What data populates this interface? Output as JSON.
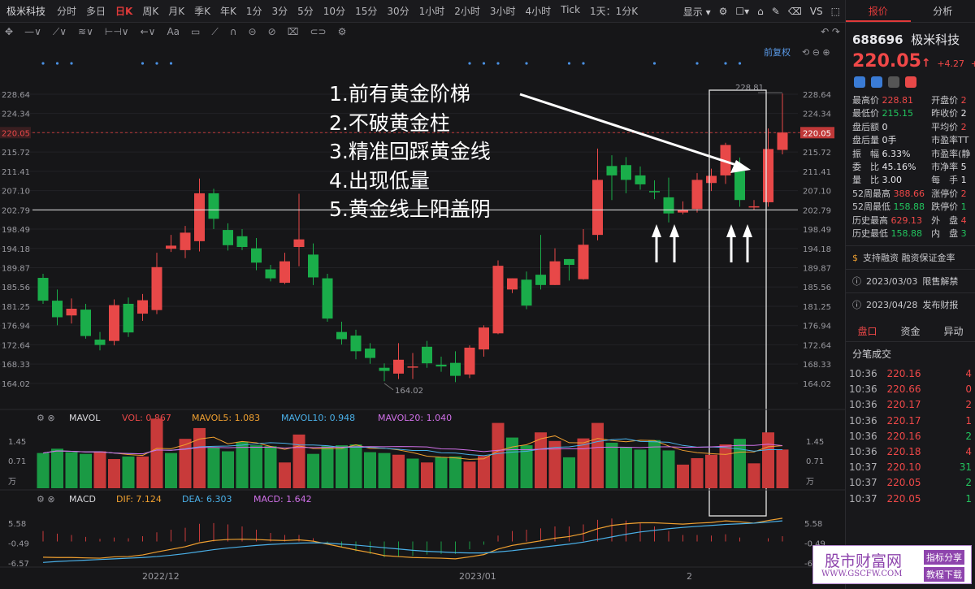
{
  "toolbar": {
    "symbol": "极米科技",
    "periods": [
      "分时",
      "多日",
      "日K",
      "周K",
      "月K",
      "季K",
      "年K",
      "1分",
      "3分",
      "5分",
      "10分",
      "15分",
      "30分",
      "1小时",
      "2小时",
      "3小时",
      "4小时",
      "Tick",
      "1天：1分K"
    ],
    "active_period": "日K",
    "display_label": "显示",
    "vs_label": "VS"
  },
  "chart": {
    "adjust_label": "前复权",
    "y_ticks": [
      "228.64",
      "224.34",
      "220.05",
      "215.72",
      "211.41",
      "207.10",
      "202.79",
      "198.49",
      "194.18",
      "189.87",
      "185.56",
      "181.25",
      "176.94",
      "172.64",
      "168.33",
      "164.02"
    ],
    "current_price_label": "220.05",
    "high_label": "228.81",
    "low_label": "164.02",
    "x_labels": [
      "2022/12",
      "2023/01",
      "2"
    ],
    "annotations": [
      "1.前有黄金阶梯",
      "2.不破黄金柱",
      "3.精准回踩黄金线",
      "4.出现低量",
      "5.黄金线上阳盖阴"
    ],
    "colors": {
      "up": "#e84848",
      "down": "#1aad4a",
      "bg": "#161618"
    }
  },
  "mavol": {
    "name": "MAVOL",
    "vol_label": "VOL:",
    "vol": "0.867",
    "ma5_label": "MAVOL5:",
    "ma5": "1.083",
    "ma10_label": "MAVOL10:",
    "ma10": "0.948",
    "ma20_label": "MAVOL20:",
    "ma20": "1.040",
    "y_ticks": [
      "1.45",
      "0.71",
      "万"
    ]
  },
  "macd": {
    "name": "MACD",
    "dif_label": "DIF:",
    "dif": "7.124",
    "dea_label": "DEA:",
    "dea": "6.303",
    "macd_label": "MACD:",
    "macd": "1.642",
    "y_ticks": [
      "5.58",
      "-0.49",
      "-6.57"
    ]
  },
  "chart_data": {
    "type": "candlestick",
    "candles": [
      [
        187.6,
        182.5,
        188.5,
        181.8
      ],
      [
        182.5,
        178.8,
        185.0,
        177.0
      ],
      [
        179.2,
        180.7,
        183.0,
        177.4
      ],
      [
        180.5,
        174.6,
        181.8,
        174.0
      ],
      [
        173.8,
        172.6,
        175.5,
        171.4
      ],
      [
        173.5,
        181.5,
        182.8,
        172.5
      ],
      [
        181.8,
        175.4,
        183.2,
        174.4
      ],
      [
        179.6,
        182.6,
        184.0,
        178.0
      ],
      [
        180.4,
        190.0,
        193.2,
        179.5
      ],
      [
        194.1,
        194.8,
        197.2,
        193.4
      ],
      [
        193.8,
        197.7,
        199.2,
        192.0
      ],
      [
        195.8,
        206.5,
        209.8,
        193.5
      ],
      [
        206.5,
        200.8,
        207.5,
        198.5
      ],
      [
        198.3,
        194.9,
        199.8,
        193.7
      ],
      [
        196.9,
        194.5,
        198.5,
        193.8
      ],
      [
        194.2,
        191.0,
        196.5,
        189.3
      ],
      [
        189.5,
        187.5,
        190.5,
        186.8
      ],
      [
        186.5,
        191.3,
        193.2,
        186.2
      ],
      [
        194.5,
        196.2,
        206.4,
        190.2
      ],
      [
        192.8,
        187.7,
        195.3,
        186.0
      ],
      [
        187.5,
        178.5,
        188.5,
        177.8
      ],
      [
        175.5,
        173.9,
        177.8,
        172.7
      ],
      [
        174.7,
        171.2,
        176.0,
        169.4
      ],
      [
        171.8,
        169.7,
        173.0,
        168.4
      ],
      [
        167.5,
        166.8,
        168.5,
        164.5
      ],
      [
        166.2,
        169.3,
        173.0,
        165.0
      ],
      [
        167.8,
        167.8,
        170.8,
        165.0
      ],
      [
        172.2,
        168.5,
        173.5,
        167.5
      ],
      [
        168.2,
        167.8,
        170.0,
        166.6
      ],
      [
        168.6,
        165.7,
        171.2,
        164.3
      ],
      [
        166.0,
        172.0,
        172.5,
        165.2
      ],
      [
        171.6,
        176.5,
        177.0,
        170.0
      ],
      [
        175.2,
        190.3,
        191.5,
        175.0
      ],
      [
        185.0,
        187.5,
        187.5,
        184.2
      ],
      [
        187.2,
        181.4,
        189.0,
        180.6
      ],
      [
        188.3,
        186.0,
        197.2,
        185.0
      ],
      [
        186.0,
        191.3,
        194.2,
        186.0
      ],
      [
        191.8,
        190.5,
        191.8,
        187.0
      ],
      [
        187.3,
        195.0,
        198.5,
        187.2
      ],
      [
        197.2,
        209.5,
        216.5,
        196.0
      ],
      [
        212.6,
        210.5,
        215.0,
        205.0
      ],
      [
        212.8,
        209.5,
        214.6,
        206.5
      ],
      [
        210.5,
        208.5,
        212.5,
        207.3
      ],
      [
        207.0,
        206.8,
        209.4,
        205.2
      ],
      [
        205.6,
        202.0,
        210.0,
        200.0
      ],
      [
        202.2,
        202.8,
        204.7,
        201.8
      ],
      [
        203.0,
        209.5,
        211.0,
        202.2
      ],
      [
        208.8,
        210.4,
        212.0,
        207.0
      ],
      [
        210.5,
        217.3,
        217.8,
        208.6
      ],
      [
        211.5,
        205.0,
        214.5,
        203.5
      ],
      [
        203.5,
        203.6,
        205.0,
        202.8
      ],
      [
        204.5,
        216.4,
        221.0,
        203.5
      ],
      [
        216.2,
        220.1,
        228.8,
        215.2
      ]
    ],
    "high": 228.81,
    "low": 164.02,
    "ylim": [
      162.0,
      231.0
    ],
    "horizontal_line": 202.79,
    "volume": [
      [
        0.82,
        0
      ],
      [
        0.92,
        0
      ],
      [
        0.84,
        0
      ],
      [
        0.8,
        0
      ],
      [
        0.86,
        1
      ],
      [
        0.68,
        1
      ],
      [
        0.74,
        0
      ],
      [
        0.74,
        1
      ],
      [
        1.62,
        1
      ],
      [
        0.82,
        0
      ],
      [
        1.15,
        1
      ],
      [
        1.4,
        1
      ],
      [
        0.95,
        0
      ],
      [
        0.86,
        0
      ],
      [
        1.08,
        0
      ],
      [
        1.0,
        0
      ],
      [
        0.98,
        0
      ],
      [
        0.6,
        1
      ],
      [
        1.25,
        1
      ],
      [
        0.8,
        0
      ],
      [
        0.98,
        0
      ],
      [
        1.0,
        0
      ],
      [
        1.02,
        0
      ],
      [
        0.84,
        0
      ],
      [
        0.82,
        0
      ],
      [
        0.78,
        1
      ],
      [
        0.69,
        0
      ],
      [
        0.6,
        1
      ],
      [
        0.72,
        0
      ],
      [
        0.74,
        0
      ],
      [
        0.62,
        1
      ],
      [
        0.75,
        1
      ],
      [
        1.52,
        1
      ],
      [
        1.18,
        0
      ],
      [
        1.0,
        0
      ],
      [
        1.3,
        1
      ],
      [
        1.1,
        1
      ],
      [
        0.72,
        0
      ],
      [
        1.16,
        1
      ],
      [
        1.52,
        1
      ],
      [
        1.06,
        0
      ],
      [
        0.95,
        0
      ],
      [
        0.9,
        0
      ],
      [
        1.12,
        0
      ],
      [
        0.88,
        0
      ],
      [
        0.55,
        1
      ],
      [
        0.7,
        1
      ],
      [
        0.78,
        1
      ],
      [
        1.02,
        1
      ],
      [
        1.15,
        0
      ],
      [
        0.58,
        1
      ],
      [
        1.3,
        1
      ],
      [
        0.9,
        1
      ]
    ],
    "macd_dif": [
      -4.8,
      -4.9,
      -4.9,
      -5.0,
      -5.1,
      -4.7,
      -4.6,
      -4.1,
      -3.2,
      -2.4,
      -1.6,
      -0.4,
      0.3,
      0.6,
      0.7,
      0.6,
      0.4,
      0.3,
      0.5,
      0.1,
      -0.8,
      -1.7,
      -2.6,
      -3.4,
      -4.3,
      -4.6,
      -4.9,
      -5.0,
      -5.1,
      -5.3,
      -4.7,
      -4.0,
      -2.3,
      -1.2,
      -0.5,
      0.2,
      1.0,
      1.5,
      2.4,
      3.9,
      4.9,
      5.4,
      5.7,
      5.7,
      5.5,
      5.3,
      5.6,
      5.8,
      6.3,
      6.0,
      5.6,
      6.4,
      7.1
    ],
    "macd_dea": [
      -6.4,
      -6.1,
      -5.9,
      -5.7,
      -5.5,
      -5.3,
      -5.1,
      -4.9,
      -4.6,
      -4.2,
      -3.7,
      -3.1,
      -2.5,
      -2.0,
      -1.6,
      -1.2,
      -0.9,
      -0.7,
      -0.5,
      -0.4,
      -0.5,
      -0.8,
      -1.1,
      -1.5,
      -1.9,
      -2.3,
      -2.7,
      -3.0,
      -3.2,
      -3.4,
      -3.5,
      -3.5,
      -3.2,
      -2.8,
      -2.3,
      -1.8,
      -1.3,
      -0.8,
      -0.2,
      0.6,
      1.4,
      2.2,
      2.9,
      3.4,
      3.9,
      4.3,
      4.6,
      4.9,
      5.2,
      5.4,
      5.6,
      5.9,
      6.3
    ],
    "marker_arrows_after": [
      45,
      46,
      51,
      52
    ],
    "series": [
      {
        "name": "MAVOL5"
      },
      {
        "name": "MAVOL10"
      },
      {
        "name": "MAVOL20"
      },
      {
        "name": "DIF"
      },
      {
        "name": "DEA"
      }
    ]
  },
  "quote": {
    "code": "688696",
    "name": "极米科技",
    "price": "220.05",
    "change": "+4.27",
    "change_pct": "+1",
    "tabs": [
      "报价",
      "分析"
    ],
    "rows": [
      {
        "l": "最高价",
        "lv": "228.81",
        "lc": "red",
        "r": "开盘价",
        "rv": "2",
        "rc": "red"
      },
      {
        "l": "最低价",
        "lv": "215.15",
        "lc": "grn",
        "r": "昨收价",
        "rv": "2",
        "rc": "wht"
      },
      {
        "l": "盘后额",
        "lv": "0",
        "lc": "wht",
        "r": "平均价",
        "rv": "2",
        "rc": "red"
      },
      {
        "l": "盘后量",
        "lv": "0手",
        "lc": "wht",
        "r": "市盈率TT",
        "rv": "",
        "rc": "wht"
      },
      {
        "l": "振　幅",
        "lv": "6.33%",
        "lc": "wht",
        "r": "市盈率(静",
        "rv": "",
        "rc": "wht"
      },
      {
        "l": "委　比",
        "lv": "45.16%",
        "lc": "wht",
        "r": "市净率",
        "rv": "5",
        "rc": "wht"
      },
      {
        "l": "量　比",
        "lv": "3.00",
        "lc": "wht",
        "r": "每　手",
        "rv": "1",
        "rc": "wht"
      },
      {
        "l": "52周最高",
        "lv": "388.66",
        "lc": "red",
        "r": "涨停价",
        "rv": "2",
        "rc": "red"
      },
      {
        "l": "52周最低",
        "lv": "158.88",
        "lc": "grn",
        "r": "跌停价",
        "rv": "1",
        "rc": "grn"
      },
      {
        "l": "历史最高",
        "lv": "629.13",
        "lc": "red",
        "r": "外　盘",
        "rv": "4",
        "rc": "red"
      },
      {
        "l": "历史最低",
        "lv": "158.88",
        "lc": "grn",
        "r": "内　盘",
        "rv": "3",
        "rc": "grn"
      }
    ],
    "margin": "支持融资 融资保证金率",
    "event1_date": "2023/03/03",
    "event1": "限售解禁",
    "event2_date": "2023/04/28",
    "event2": "发布财报",
    "tabs2": [
      "盘口",
      "资金",
      "异动"
    ],
    "ticks_title": "分笔成交",
    "ticks": [
      {
        "t": "10:36",
        "p": "220.16",
        "v": "4",
        "c": "red"
      },
      {
        "t": "10:36",
        "p": "220.66",
        "v": "0",
        "c": "red"
      },
      {
        "t": "10:36",
        "p": "220.17",
        "v": "2",
        "c": "red"
      },
      {
        "t": "10:36",
        "p": "220.17",
        "v": "1",
        "c": "red"
      },
      {
        "t": "10:36",
        "p": "220.16",
        "v": "2",
        "c": "grn"
      },
      {
        "t": "10:36",
        "p": "220.18",
        "v": "4",
        "c": "red"
      },
      {
        "t": "10:37",
        "p": "220.10",
        "v": "31",
        "c": "grn"
      },
      {
        "t": "10:37",
        "p": "220.05",
        "v": "2",
        "c": "grn"
      },
      {
        "t": "10:37",
        "p": "220.05",
        "v": "1",
        "c": "grn"
      }
    ]
  },
  "watermark": {
    "title": "股市财富网",
    "tag1": "指标分享",
    "tag2": "教程下载",
    "url": "WWW.GSCFW.COM"
  }
}
